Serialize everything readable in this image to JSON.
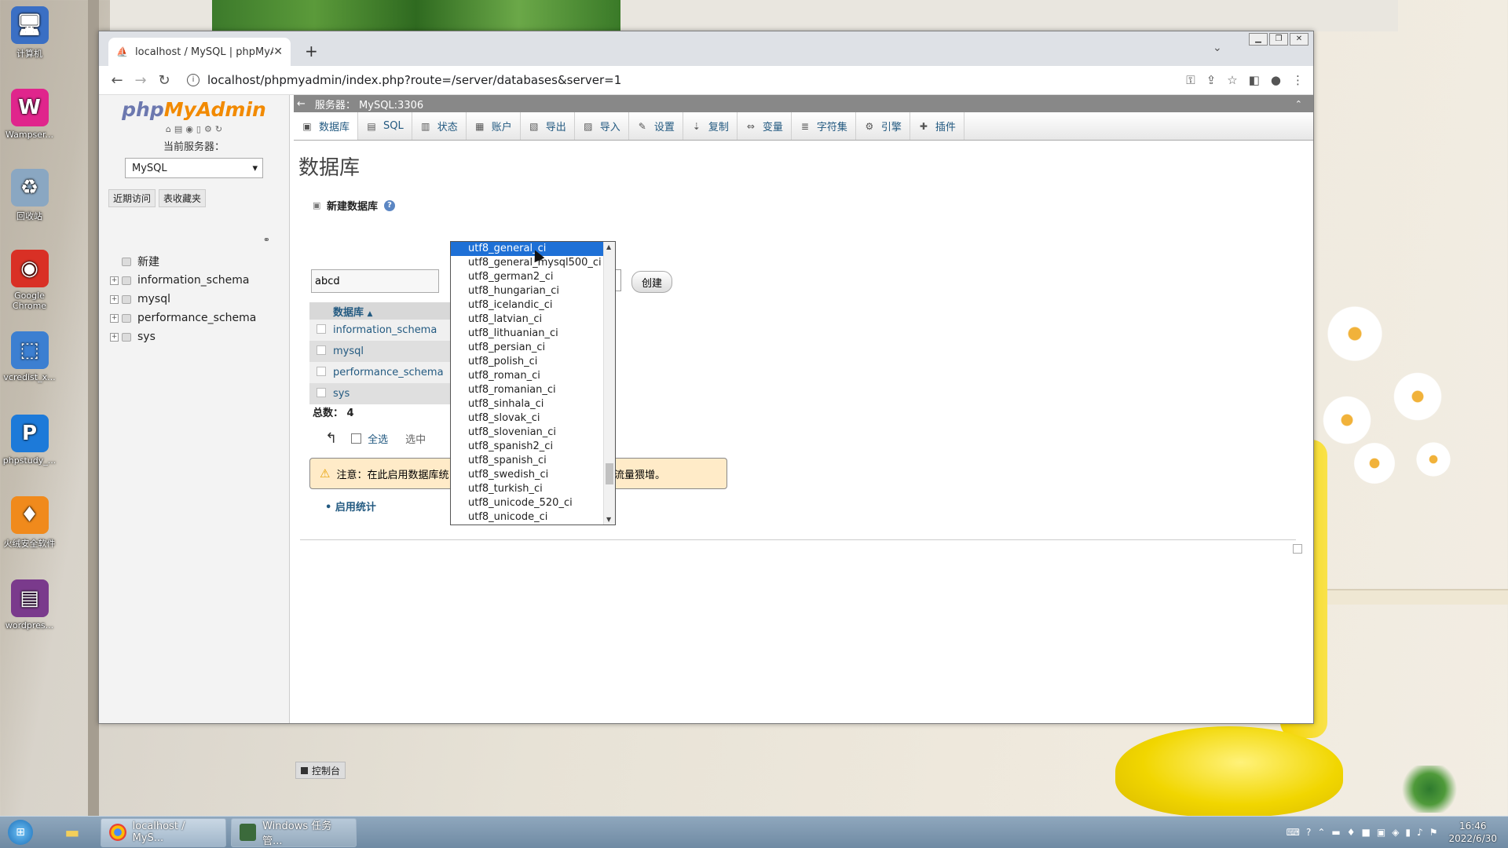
{
  "desktop": {
    "icons": [
      {
        "label": "计算机",
        "icon": "computer-icon",
        "color": "#3a6fc4",
        "glyph": "🖥"
      },
      {
        "label": "Wampser...",
        "icon": "wampserver-icon",
        "color": "#e0258c",
        "glyph": "W"
      },
      {
        "label": "回收站",
        "icon": "recycle-bin-icon",
        "color": "#8aa7c2",
        "glyph": "♻"
      },
      {
        "label": "Google Chrome",
        "icon": "chrome-icon",
        "color": "#d93025",
        "glyph": "◉"
      },
      {
        "label": "vcredist_x...",
        "icon": "installer-icon",
        "color": "#3c7fd1",
        "glyph": "⬚"
      },
      {
        "label": "phpstudy_...",
        "icon": "phpstudy-icon",
        "color": "#1d7ad9",
        "glyph": "P"
      },
      {
        "label": "火绒安全软件",
        "icon": "huorong-icon",
        "color": "#f08a1c",
        "glyph": "♦"
      },
      {
        "label": "wordpres...",
        "icon": "winrar-icon",
        "color": "#7a3a8c",
        "glyph": "▤"
      }
    ]
  },
  "browser": {
    "tab_title": "localhost / MySQL | phpMyAd",
    "tab_close": "✕",
    "new_tab": "+",
    "url": "localhost/phpmyadmin/index.php?route=/server/databases&server=1"
  },
  "sidebar": {
    "logo_php": "php",
    "logo_my": "MyAdmin",
    "current_server_label": "当前服务器：",
    "server_value": "MySQL",
    "tab_recent": "近期访问",
    "tab_favorites": "表收藏夹",
    "tree": [
      {
        "label": "新建",
        "expandable": false
      },
      {
        "label": "information_schema",
        "expandable": true
      },
      {
        "label": "mysql",
        "expandable": true
      },
      {
        "label": "performance_schema",
        "expandable": true
      },
      {
        "label": "sys",
        "expandable": true
      }
    ]
  },
  "main": {
    "server_label": "服务器： MySQL:3306",
    "menu": [
      {
        "label": "数据库",
        "icon": "database-icon",
        "glyph": "▣"
      },
      {
        "label": "SQL",
        "icon": "sql-icon",
        "glyph": "▤"
      },
      {
        "label": "状态",
        "icon": "status-icon",
        "glyph": "▥"
      },
      {
        "label": "账户",
        "icon": "accounts-icon",
        "glyph": "▦"
      },
      {
        "label": "导出",
        "icon": "export-icon",
        "glyph": "▧"
      },
      {
        "label": "导入",
        "icon": "import-icon",
        "glyph": "▨"
      },
      {
        "label": "设置",
        "icon": "settings-icon",
        "glyph": "✎"
      },
      {
        "label": "复制",
        "icon": "replication-icon",
        "glyph": "⇣"
      },
      {
        "label": "变量",
        "icon": "variables-icon",
        "glyph": "⇔"
      },
      {
        "label": "字符集",
        "icon": "charset-icon",
        "glyph": "≣"
      },
      {
        "label": "引擎",
        "icon": "engine-icon",
        "glyph": "⚙"
      },
      {
        "label": "插件",
        "icon": "plugin-icon",
        "glyph": "✚"
      }
    ],
    "page_title": "数据库",
    "new_db_label": "新建数据库",
    "db_name_value": "abcd",
    "collation_value": "utf8_unicode_ci",
    "create_label": "创建",
    "table_header": "数据库",
    "databases": [
      "information_schema",
      "mysql",
      "performance_schema",
      "sys"
    ],
    "total_label": "总数： 4",
    "select_all_label": "全选",
    "selected_label": "选中",
    "notice_start": "注意：在此启用数据库统",
    "notice_end": "务器之间的流量猥增。",
    "enable_stats": "启用统计",
    "console_label": "控制台"
  },
  "dropdown": {
    "selected": "utf8_general_ci",
    "options": [
      "utf8_general_ci",
      "utf8_general_mysql500_ci",
      "utf8_german2_ci",
      "utf8_hungarian_ci",
      "utf8_icelandic_ci",
      "utf8_latvian_ci",
      "utf8_lithuanian_ci",
      "utf8_persian_ci",
      "utf8_polish_ci",
      "utf8_roman_ci",
      "utf8_romanian_ci",
      "utf8_sinhala_ci",
      "utf8_slovak_ci",
      "utf8_slovenian_ci",
      "utf8_spanish2_ci",
      "utf8_spanish_ci",
      "utf8_swedish_ci",
      "utf8_turkish_ci",
      "utf8_unicode_520_ci",
      "utf8_unicode_ci"
    ]
  },
  "taskbar": {
    "chrome_label": "localhost / MyS...",
    "taskmgr_label": "Windows 任务管...",
    "time": "16:46",
    "date": "2022/6/30"
  }
}
